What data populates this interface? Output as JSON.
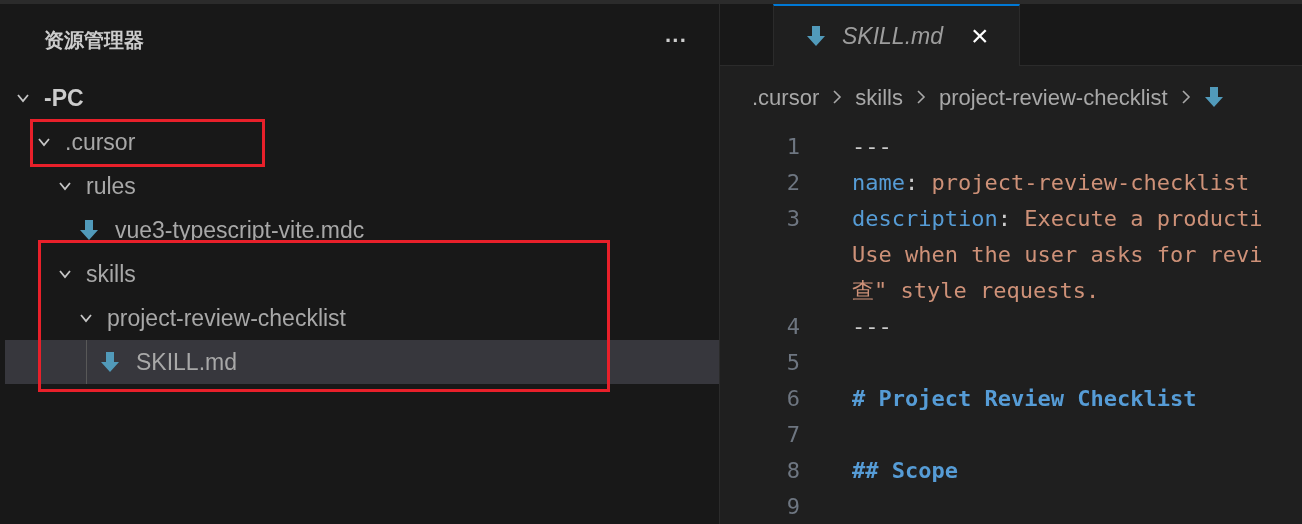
{
  "sidebar": {
    "title": "资源管理器",
    "more_label": "···",
    "tree": [
      {
        "label": "-PC",
        "expanded": true,
        "selected": false,
        "children": [
          {
            "label": ".cursor",
            "expanded": true,
            "selected": false,
            "framed_row": true,
            "children": [
              {
                "label": "rules",
                "expanded": true,
                "selected": false,
                "children": [
                  {
                    "label": "vue3-typescript-vite.mdc",
                    "kind": "file",
                    "selected": false
                  }
                ]
              },
              {
                "label": "skills",
                "expanded": true,
                "selected": false,
                "framed_subtree": true,
                "children": [
                  {
                    "label": "project-review-checklist",
                    "expanded": true,
                    "selected": false,
                    "children": [
                      {
                        "label": "SKILL.md",
                        "kind": "file",
                        "selected": true
                      }
                    ]
                  }
                ]
              }
            ]
          }
        ]
      }
    ]
  },
  "tabs": [
    {
      "label": "SKILL.md",
      "selected": true,
      "preview": true,
      "close": "×"
    }
  ],
  "breadcrumbs": [
    ".cursor",
    "skills",
    "project-review-checklist"
  ],
  "breadcrumb_file_icon": true,
  "code_lines": [
    {
      "number": "1",
      "segments": [
        [
          {
            "text": "---",
            "kind": "punct"
          }
        ]
      ]
    },
    {
      "number": "2",
      "segments": [
        [
          {
            "text": "name",
            "kind": "key"
          },
          {
            "text": ": ",
            "kind": "punct"
          },
          {
            "text": "project-review-checklist",
            "kind": "string"
          }
        ]
      ]
    },
    {
      "number": "3",
      "segments": [
        [
          {
            "text": "description",
            "kind": "key"
          },
          {
            "text": ": ",
            "kind": "punct"
          },
          {
            "text": "Execute a producti",
            "kind": "string"
          }
        ],
        [
          {
            "text": "Use when the user asks for revi",
            "kind": "string"
          }
        ],
        [
          {
            "text": "查\" style requests.",
            "kind": "string"
          }
        ]
      ]
    },
    {
      "number": "4",
      "segments": [
        [
          {
            "text": "---",
            "kind": "punct"
          }
        ]
      ]
    },
    {
      "number": "5"
    },
    {
      "number": "6",
      "segments": [
        [
          {
            "text": "# Project Review Checklist",
            "kind": "heading"
          }
        ]
      ]
    },
    {
      "number": "7"
    },
    {
      "number": "8",
      "segments": [
        [
          {
            "text": "## Scope",
            "kind": "heading"
          }
        ]
      ]
    },
    {
      "number": "9"
    }
  ]
}
